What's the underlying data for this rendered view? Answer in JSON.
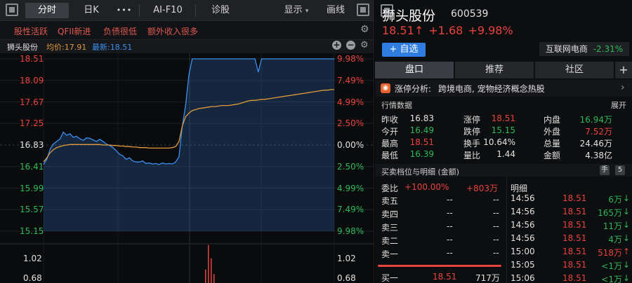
{
  "toolbar": {
    "tab_fenshi": "分时",
    "tab_rik": "日K",
    "more": "•••",
    "ai_f10": "AI-F10",
    "zhengu": "诊股",
    "display": "显示",
    "draw": "画线"
  },
  "tags": [
    "股性活跃",
    "QFII新进",
    "负债很低",
    "额外收入很多"
  ],
  "info": {
    "name": "狮头股份",
    "avg_label": "均价:",
    "avg_value": "17.91",
    "latest_label": "最新:",
    "latest_value": "18.51"
  },
  "price_axis": {
    "left": [
      "18.51",
      "18.09",
      "17.67",
      "17.25",
      "16.83",
      "16.41",
      "15.99",
      "15.57",
      "15.15"
    ],
    "right": [
      "9.98%",
      "7.49%",
      "4.99%",
      "2.50%",
      "0.00%",
      "2.50%",
      "4.99%",
      "7.49%",
      "9.98%"
    ]
  },
  "volume_axis": {
    "left": [
      "1.02",
      "0.68"
    ],
    "right": [
      "1.02",
      "0.68"
    ]
  },
  "chart_data": {
    "type": "line",
    "title": "",
    "ylim": [
      15.15,
      18.51
    ],
    "prev_close": 16.83,
    "series": [
      {
        "name": "最新",
        "values": [
          16.45,
          16.55,
          16.75,
          16.85,
          16.9,
          16.95,
          17.08,
          17.02,
          17.05,
          16.98,
          17.0,
          16.95,
          16.92,
          16.97,
          16.96,
          16.93,
          16.9,
          16.94,
          16.9,
          16.85,
          16.82,
          16.78,
          16.72,
          16.65,
          16.62,
          16.55,
          16.58,
          16.52,
          16.5,
          16.5,
          16.52,
          16.47,
          16.48,
          16.46,
          16.47,
          16.45,
          16.48,
          16.46,
          16.47,
          16.46,
          16.5,
          16.6,
          17.2,
          17.6,
          18.2,
          18.51,
          18.51,
          18.51,
          18.51,
          18.51,
          18.51,
          18.51,
          18.51,
          18.51,
          18.51,
          18.51,
          18.51,
          18.51,
          18.51,
          18.51,
          18.51,
          18.51,
          18.51,
          18.51,
          18.51,
          18.25,
          18.51,
          18.51,
          18.51,
          18.51,
          18.51,
          18.51,
          18.51,
          18.51,
          18.51,
          18.51,
          18.51,
          18.51,
          18.51,
          18.51,
          18.51,
          18.51,
          18.51,
          18.51,
          18.51,
          18.51,
          18.51,
          18.51,
          18.51
        ]
      },
      {
        "name": "均价",
        "values": [
          16.5,
          16.58,
          16.68,
          16.74,
          16.78,
          16.8,
          16.82,
          16.83,
          16.84,
          16.84,
          16.84,
          16.84,
          16.84,
          16.84,
          16.84,
          16.84,
          16.84,
          16.84,
          16.83,
          16.83,
          16.83,
          16.82,
          16.82,
          16.81,
          16.81,
          16.8,
          16.8,
          16.79,
          16.79,
          16.78,
          16.78,
          16.78,
          16.77,
          16.77,
          16.77,
          16.77,
          16.77,
          16.77,
          16.77,
          16.78,
          16.8,
          16.9,
          17.2,
          17.38,
          17.45,
          17.5,
          17.52,
          17.54,
          17.55,
          17.56,
          17.57,
          17.58,
          17.58,
          17.59,
          17.6,
          17.6,
          17.6,
          17.61,
          17.62,
          17.63,
          17.65,
          17.67,
          17.69,
          17.7,
          17.7,
          17.71,
          17.72,
          17.72,
          17.73,
          17.74,
          17.75,
          17.76,
          17.77,
          17.78,
          17.79,
          17.8,
          17.81,
          17.82,
          17.83,
          17.84,
          17.85,
          17.86,
          17.87,
          17.88,
          17.89,
          17.9,
          17.9,
          17.91,
          17.91
        ]
      }
    ]
  },
  "volume_bars": [
    0.3,
    0.85,
    0.55,
    0.2
  ],
  "stock": {
    "name": "狮头股份",
    "code": "600539",
    "price": "18.51",
    "arrow": "↑",
    "change": "+1.68",
    "pct": "+9.98%",
    "add_btn": "+ 自选",
    "sector": "互联网电商",
    "sector_pct": "-2.31%"
  },
  "tabs": [
    "盘口",
    "推荐",
    "社区"
  ],
  "tab_plus": "+",
  "limitup": {
    "label": "涨停分析:",
    "text": "跨境电商, 宠物经济概念热股",
    "arrow": "›"
  },
  "market": {
    "title": "行情数据",
    "expand": "展开",
    "rows": [
      [
        {
          "k": "昨收",
          "v": "16.83",
          "c": "white"
        },
        {
          "k": "涨停",
          "v": "18.51",
          "c": "red"
        },
        {
          "k": "内盘",
          "v": "16.94万",
          "c": "green"
        }
      ],
      [
        {
          "k": "今开",
          "v": "16.49",
          "c": "green"
        },
        {
          "k": "跌停",
          "v": "15.15",
          "c": "green"
        },
        {
          "k": "外盘",
          "v": "7.52万",
          "c": "red"
        }
      ],
      [
        {
          "k": "最高",
          "v": "18.51",
          "c": "red"
        },
        {
          "k": "换手",
          "v": "10.64%",
          "c": "white"
        },
        {
          "k": "总量",
          "v": "24.46万",
          "c": "white"
        }
      ],
      [
        {
          "k": "最低",
          "v": "16.39",
          "c": "green"
        },
        {
          "k": "量比",
          "v": "1.44",
          "c": "white"
        },
        {
          "k": "金额",
          "v": "4.38亿",
          "c": "white"
        }
      ]
    ]
  },
  "orderbook": {
    "title": "买卖档位与明细 (金额)",
    "badge_hand": "手",
    "badge_num": "5",
    "webi_label": "委比",
    "webi_pct": "+100.00%",
    "webi_amt": "+803万",
    "detail_label": "明细",
    "asks": [
      {
        "label": "卖五",
        "p": "--",
        "v": "--"
      },
      {
        "label": "卖四",
        "p": "--",
        "v": "--"
      },
      {
        "label": "卖三",
        "p": "--",
        "v": "--"
      },
      {
        "label": "卖二",
        "p": "--",
        "v": "--"
      },
      {
        "label": "卖一",
        "p": "--",
        "v": "--"
      }
    ],
    "bid1": {
      "label": "买一",
      "p": "18.51",
      "v": "717万"
    }
  },
  "ticks": [
    {
      "t": "14:56",
      "p": "18.51",
      "v": "6万",
      "a": "↓",
      "c": "green"
    },
    {
      "t": "14:56",
      "p": "18.51",
      "v": "165万",
      "a": "↓",
      "c": "green"
    },
    {
      "t": "14:56",
      "p": "18.51",
      "v": "11万",
      "a": "↓",
      "c": "green"
    },
    {
      "t": "14:56",
      "p": "18.51",
      "v": "4万",
      "a": "↓",
      "c": "green"
    },
    {
      "t": "15:00",
      "p": "18.51",
      "v": "518万",
      "a": "↑",
      "c": "red"
    },
    {
      "t": "15:05",
      "p": "18.51",
      "v": "<1万",
      "a": "↓",
      "c": "green"
    },
    {
      "t": "15:06",
      "p": "18.51",
      "v": "<1万",
      "a": "↓",
      "c": "green"
    }
  ]
}
